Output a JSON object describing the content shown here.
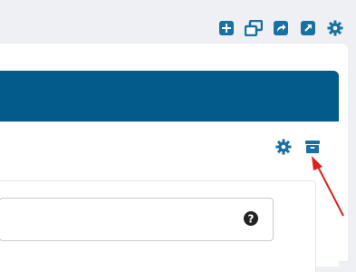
{
  "colors": {
    "accent": "#025b8a",
    "icon": "#1a6fa3",
    "annotation_arrow": "#e02020",
    "help_icon": "#222222"
  },
  "toolbar": {
    "icons": [
      "plus-square-icon",
      "restore-window-icon",
      "share-icon",
      "external-link-icon",
      "gear-icon"
    ]
  },
  "section_actions": {
    "icons": [
      "gear-icon",
      "archive-icon"
    ]
  },
  "input": {
    "value": "",
    "help_icon": "question-circle-icon"
  }
}
